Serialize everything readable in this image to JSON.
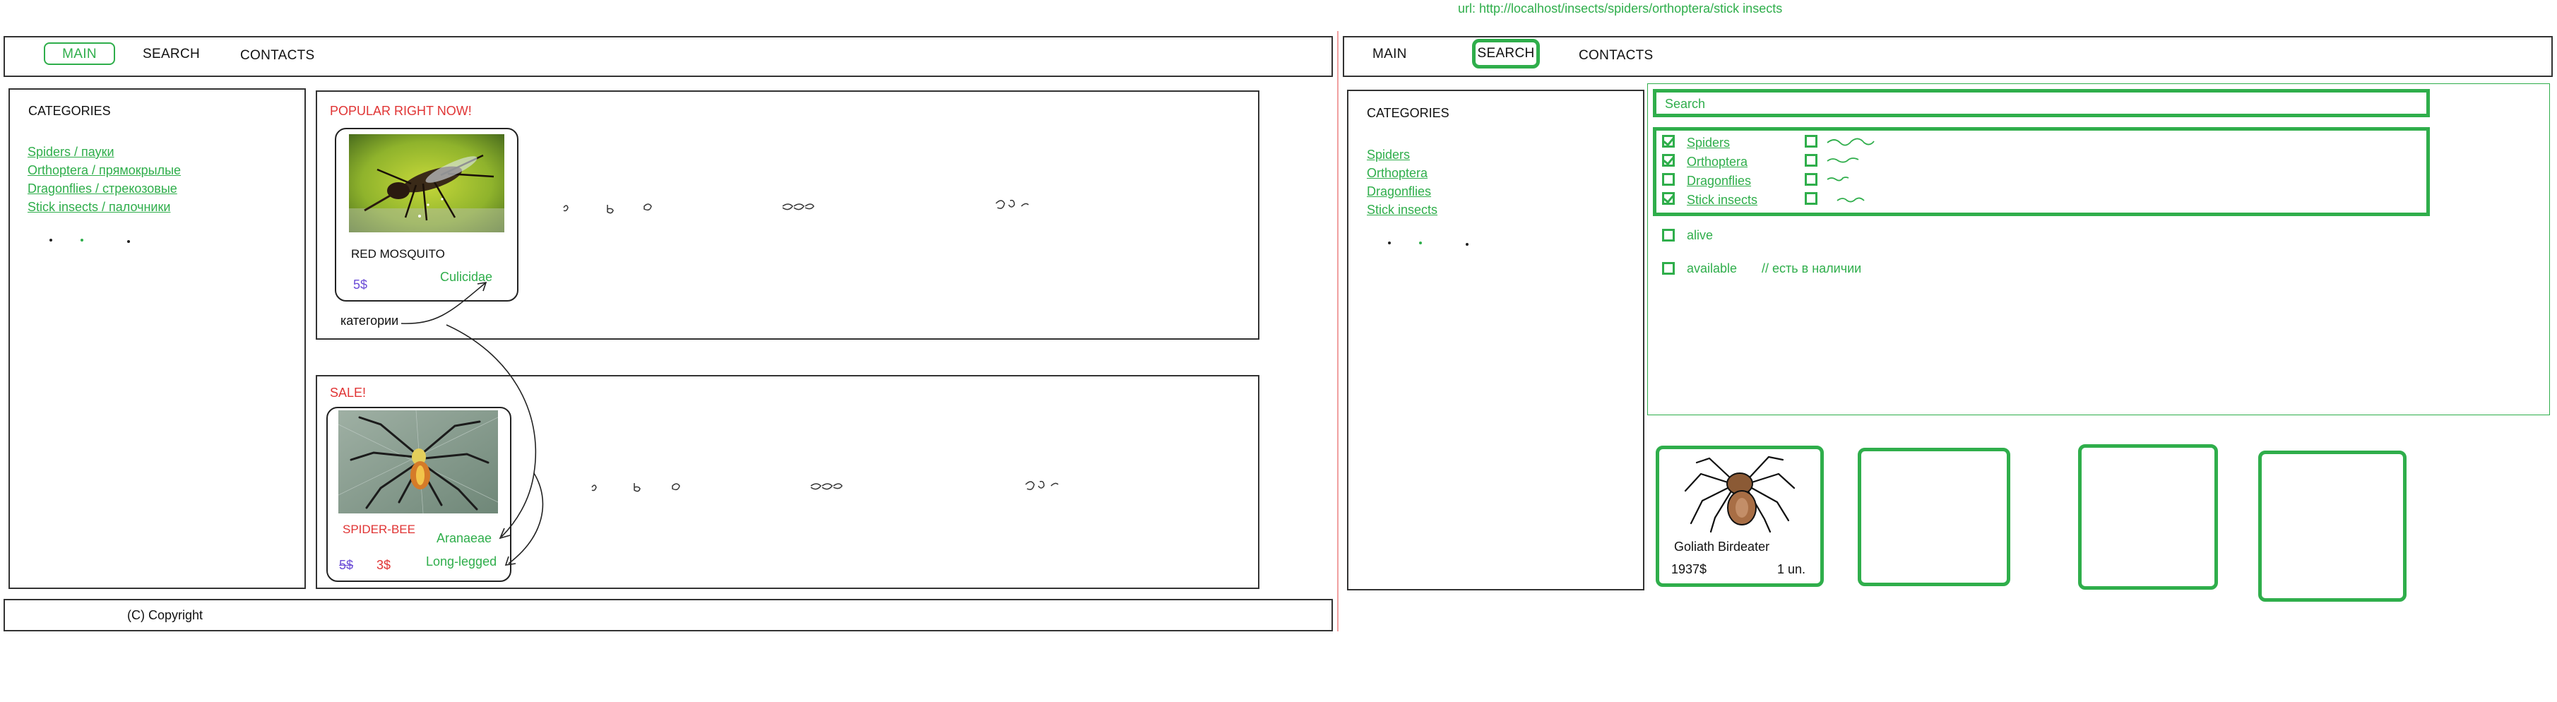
{
  "url_label": "url: http://localhost/insects/spiders/orthoptera/stick insects",
  "left": {
    "nav": {
      "main": "MAIN",
      "search": "SEARCH",
      "contacts": "CONTACTS"
    },
    "categories_title": "CATEGORIES",
    "categories": [
      "Spiders / пауки",
      "Orthoptera / прямокрылые",
      "Dragonflies / стрекозовые",
      "Stick insects / палочники"
    ],
    "popular": {
      "title": "POPULAR RIGHT NOW!",
      "product_name": "RED MOSQUITO",
      "price": "5$",
      "family": "Culicidae",
      "annotation": "категории"
    },
    "sale": {
      "title": "SALE!",
      "product_name": "SPIDER-BEE",
      "old_price": "5$",
      "new_price": "3$",
      "family": "Aranaeae",
      "type": "Long-legged"
    },
    "footer": "(C) Copyright"
  },
  "right": {
    "nav": {
      "main": "MAIN",
      "search": "SEARCH",
      "contacts": "CONTACTS"
    },
    "categories_title": "CATEGORIES",
    "categories": [
      "Spiders",
      "Orthoptera",
      "Dragonflies",
      "Stick insects"
    ],
    "search_placeholder": "Search",
    "filters": [
      {
        "label": "Spiders",
        "checked": true
      },
      {
        "label": "Orthoptera",
        "checked": true
      },
      {
        "label": "Dragonflies",
        "checked": false
      },
      {
        "label": "Stick insects",
        "checked": true
      }
    ],
    "alive_label": "alive",
    "available_label": "available",
    "available_comment": "// есть в наличии",
    "product": {
      "name": "Goliath Birdeater",
      "price": "1937$",
      "qty": "1 un."
    }
  },
  "colors": {
    "accent": "#2fae4b",
    "sale": "#e03434",
    "price": "#6a4bd6"
  }
}
